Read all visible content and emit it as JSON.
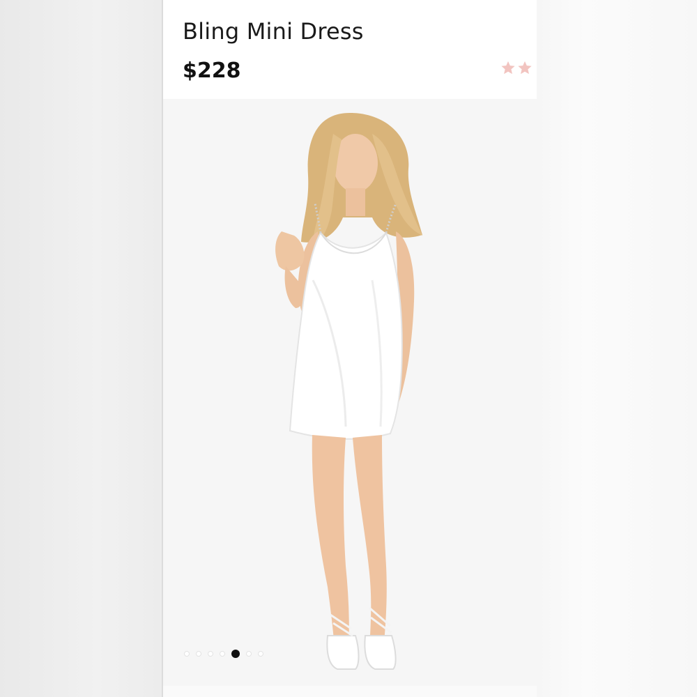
{
  "product": {
    "name": "Bling Mini Dress",
    "price": "$228",
    "rating_stars": 2,
    "star_color": "#f2c4c0"
  },
  "gallery": {
    "image": "product-photo-model-white-satin-mini-dress",
    "dot_count": 7,
    "active_index": 4
  },
  "colors": {
    "card_background": "#ffffff",
    "photo_background": "#f5f5f5",
    "text": "#1a1a1a",
    "active_dot": "#111111"
  }
}
